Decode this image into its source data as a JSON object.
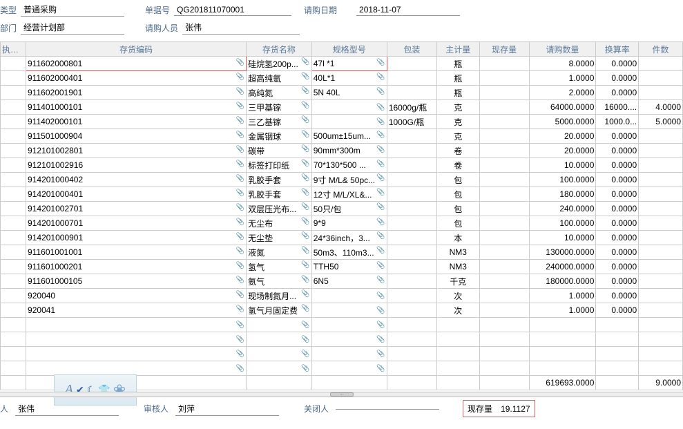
{
  "header": {
    "labels": {
      "type": "类型",
      "dept": "部门",
      "docno": "单据号",
      "buyer": "请购人员",
      "reqdate": "请购日期"
    },
    "type": "普通采购",
    "dept": "经营计划部",
    "docno": "QG201811070001",
    "buyer": "张伟",
    "reqdate": "2018-11-07"
  },
  "columns": {
    "exec": "执行人",
    "code": "存货编码",
    "name": "存货名称",
    "spec": "规格型号",
    "pack": "包装",
    "unit": "主计量",
    "stock": "现存量",
    "qty": "请购数量",
    "rate": "换算率",
    "pcs": "件数"
  },
  "rows": [
    {
      "code": "911602000801",
      "name": "硅烷氢200p...",
      "spec": "47l *1",
      "pack": "",
      "unit": "瓶",
      "qty": "8.0000",
      "rate": "0.0000",
      "pcs": ""
    },
    {
      "code": "911602000401",
      "name": "超高纯氩",
      "spec": "40L*1",
      "pack": "",
      "unit": "瓶",
      "qty": "1.0000",
      "rate": "0.0000",
      "pcs": ""
    },
    {
      "code": "911602001901",
      "name": "高纯氮",
      "spec": "5N 40L",
      "pack": "",
      "unit": "瓶",
      "qty": "2.0000",
      "rate": "0.0000",
      "pcs": ""
    },
    {
      "code": "911401000101",
      "name": "三甲基镓",
      "spec": "",
      "pack": "16000g/瓶",
      "unit": "克",
      "qty": "64000.0000",
      "rate": "16000....",
      "pcs": "4.0000"
    },
    {
      "code": "911402000101",
      "name": "三乙基镓",
      "spec": "",
      "pack": "1000G/瓶",
      "unit": "克",
      "qty": "5000.0000",
      "rate": "1000.0...",
      "pcs": "5.0000"
    },
    {
      "code": "911501000904",
      "name": "金属铟球",
      "spec": "500um±15um...",
      "pack": "",
      "unit": "克",
      "qty": "20.0000",
      "rate": "0.0000",
      "pcs": ""
    },
    {
      "code": "912101002801",
      "name": "碳带",
      "spec": "90mm*300m",
      "pack": "",
      "unit": "卷",
      "qty": "20.0000",
      "rate": "0.0000",
      "pcs": ""
    },
    {
      "code": "912101002916",
      "name": "标签打印纸",
      "spec": "70*130*500 ...",
      "pack": "",
      "unit": "卷",
      "qty": "10.0000",
      "rate": "0.0000",
      "pcs": ""
    },
    {
      "code": "914201000402",
      "name": "乳胶手套",
      "spec": "9寸 M/L& 50pc...",
      "pack": "",
      "unit": "包",
      "qty": "100.0000",
      "rate": "0.0000",
      "pcs": ""
    },
    {
      "code": "914201000401",
      "name": "乳胶手套",
      "spec": "12寸 M/L/XL&...",
      "pack": "",
      "unit": "包",
      "qty": "180.0000",
      "rate": "0.0000",
      "pcs": ""
    },
    {
      "code": "914201002701",
      "name": "双层压光布...",
      "spec": "50只/包",
      "pack": "",
      "unit": "包",
      "qty": "240.0000",
      "rate": "0.0000",
      "pcs": ""
    },
    {
      "code": "914201000701",
      "name": "无尘布",
      "spec": "9*9",
      "pack": "",
      "unit": "包",
      "qty": "100.0000",
      "rate": "0.0000",
      "pcs": ""
    },
    {
      "code": "914201000901",
      "name": "无尘垫",
      "spec": "24*36inch，3...",
      "pack": "",
      "unit": "本",
      "qty": "10.0000",
      "rate": "0.0000",
      "pcs": ""
    },
    {
      "code": "911601001001",
      "name": "液氮",
      "spec": "50m3、110m3...",
      "pack": "",
      "unit": "NM3",
      "qty": "130000.0000",
      "rate": "0.0000",
      "pcs": ""
    },
    {
      "code": "911601000201",
      "name": "氢气",
      "spec": "TTH50",
      "pack": "",
      "unit": "NM3",
      "qty": "240000.0000",
      "rate": "0.0000",
      "pcs": ""
    },
    {
      "code": "911601000105",
      "name": "氨气",
      "spec": "6N5",
      "pack": "",
      "unit": "千克",
      "qty": "180000.0000",
      "rate": "0.0000",
      "pcs": ""
    },
    {
      "code": "920040",
      "name": "现场制氮月...",
      "spec": "",
      "pack": "",
      "unit": "次",
      "qty": "1.0000",
      "rate": "0.0000",
      "pcs": ""
    },
    {
      "code": "920041",
      "name": "氢气月固定费",
      "spec": "",
      "pack": "",
      "unit": "次",
      "qty": "1.0000",
      "rate": "0.0000",
      "pcs": ""
    }
  ],
  "totals": {
    "qty": "619693.0000",
    "pcs": "9.0000"
  },
  "footer": {
    "labels": {
      "person": "人",
      "reviewer": "审核人",
      "closer": "关闭人",
      "stock": "现存量"
    },
    "person": "张伟",
    "reviewer": "刘萍",
    "closer": "",
    "stock": "19.1127"
  },
  "watermark": {
    "a": "A"
  }
}
